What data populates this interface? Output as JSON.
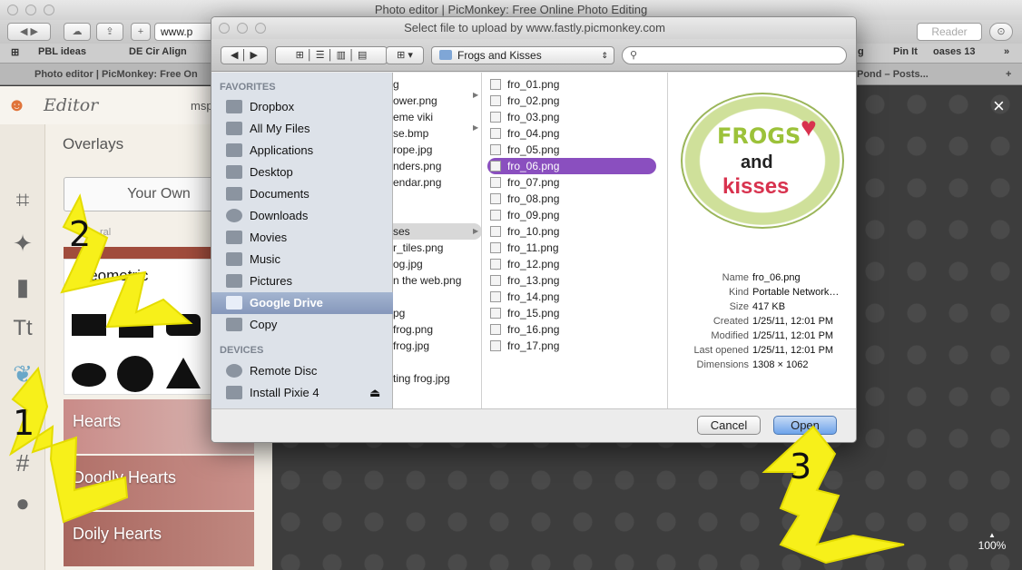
{
  "browser": {
    "title": "Photo editor | PicMonkey: Free Online Photo Editing",
    "address": "www.p",
    "reader": "Reader",
    "bookmarks_left": [
      "PBL ideas",
      "DE Cir Align"
    ],
    "bookmarks_right": [
      "g",
      "Pin It",
      "oases 13"
    ],
    "tabs": [
      "Photo editor | PicMonkey: Free On",
      "Pond – Posts..."
    ]
  },
  "editor": {
    "logo_text": "Editor",
    "user": "msp",
    "panel_title": "Overlays",
    "your_own": "Your Own",
    "section_label": "ral",
    "geometric": "Geometric",
    "overlays": [
      "Hearts",
      "Doodly Hearts",
      "Doily Hearts"
    ],
    "zoom": "100%",
    "close": "×"
  },
  "dialog": {
    "title": "Select file to upload by www.fastly.picmonkey.com",
    "folder": "Frogs and Kisses",
    "favorites_label": "FAVORITES",
    "devices_label": "DEVICES",
    "favorites": [
      "Dropbox",
      "All My Files",
      "Applications",
      "Desktop",
      "Documents",
      "Downloads",
      "Movies",
      "Music",
      "Pictures",
      "Google Drive",
      "Copy"
    ],
    "devices": [
      "Remote Disc",
      "Install Pixie 4"
    ],
    "col1": [
      "g",
      "ower.png",
      "eme viki",
      "se.bmp",
      "rope.jpg",
      "nders.png",
      "endar.png",
      "",
      "ses",
      "r_tiles.png",
      "og.jpg",
      "n the web.png",
      "",
      "pg",
      "frog.png",
      "frog.jpg",
      "",
      "ting frog.jpg"
    ],
    "files": [
      "fro_01.png",
      "fro_02.png",
      "fro_03.png",
      "fro_04.png",
      "fro_05.png",
      "fro_06.png",
      "fro_07.png",
      "fro_08.png",
      "fro_09.png",
      "fro_10.png",
      "fro_11.png",
      "fro_12.png",
      "fro_13.png",
      "fro_14.png",
      "fro_15.png",
      "fro_16.png",
      "fro_17.png"
    ],
    "preview_text": {
      "line1": "FROGS",
      "line2": "and",
      "line3": "kisses"
    },
    "meta": [
      {
        "label": "Name",
        "value": "fro_06.png"
      },
      {
        "label": "Kind",
        "value": "Portable Network…"
      },
      {
        "label": "Size",
        "value": "417 KB"
      },
      {
        "label": "Created",
        "value": "1/25/11, 12:01 PM"
      },
      {
        "label": "Modified",
        "value": "1/25/11, 12:01 PM"
      },
      {
        "label": "Last opened",
        "value": "1/25/11, 12:01 PM"
      },
      {
        "label": "Dimensions",
        "value": "1308 × 1062"
      }
    ],
    "cancel": "Cancel",
    "open": "Open"
  },
  "annotations": {
    "n1": "1",
    "n2": "2",
    "n3": "3"
  },
  "colors": {
    "selection": "#8a4fbf",
    "arrow": "#f7f01a"
  }
}
